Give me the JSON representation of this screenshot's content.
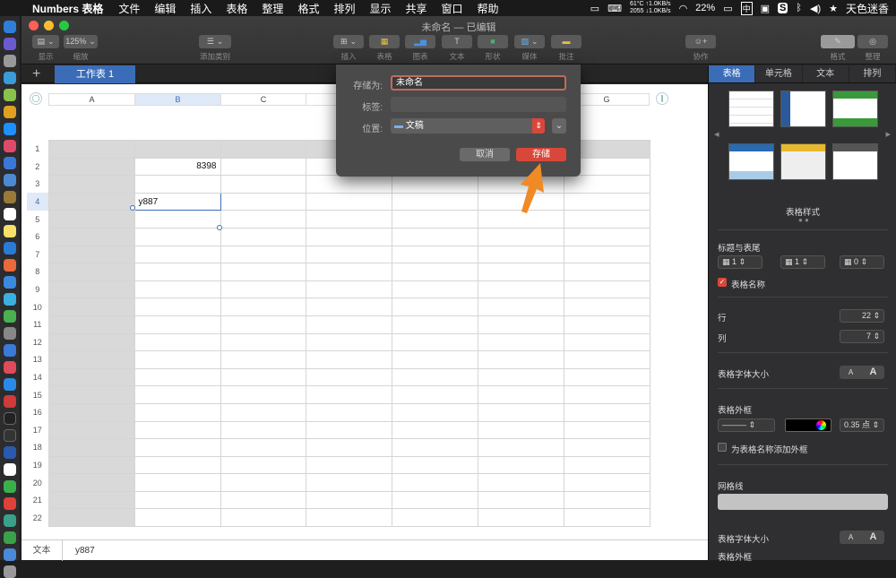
{
  "menubar": {
    "app_name": "Numbers 表格",
    "items": [
      "文件",
      "编辑",
      "插入",
      "表格",
      "整理",
      "格式",
      "排列",
      "显示",
      "共享",
      "窗口",
      "帮助"
    ],
    "temp": "61°C",
    "fan": "2055",
    "net_up": "↑1.0KB/s",
    "net_down": "↓1.0KB/s",
    "battery": "22%",
    "input_method": "中",
    "user": "天色迷香"
  },
  "window": {
    "title": "未命名 — 已编辑",
    "toolbar": {
      "view": "显示",
      "zoom_value": "125%",
      "zoom": "缩放",
      "add_category": "添加类别",
      "insert": "插入",
      "table": "表格",
      "chart": "图表",
      "text": "文本",
      "shape": "形状",
      "media": "媒体",
      "comment": "批注",
      "collaborate": "协作",
      "format": "格式",
      "organize": "整理"
    }
  },
  "sheet": {
    "tab_label": "工作表 1",
    "columns": [
      "A",
      "B",
      "C",
      "D",
      "E",
      "F",
      "G"
    ],
    "rows": [
      "1",
      "2",
      "3",
      "4",
      "5",
      "6",
      "7",
      "8",
      "9",
      "10",
      "11",
      "12",
      "13",
      "14",
      "15",
      "16",
      "17",
      "18",
      "19",
      "20",
      "21",
      "22"
    ],
    "cells": {
      "B2": "8398",
      "B4": "y887"
    }
  },
  "statusbar": {
    "label": "文本",
    "value": "y887"
  },
  "inspector": {
    "tabs": [
      "表格",
      "单元格",
      "文本",
      "排列"
    ],
    "styles_label": "表格样式",
    "headers_label": "标题与表尾",
    "header_rows": "1",
    "header_cols": "1",
    "footer_rows": "0",
    "table_name_label": "表格名称",
    "rows_label": "行",
    "rows_value": "22",
    "cols_label": "列",
    "cols_value": "7",
    "font_size_label": "表格字体大小",
    "font_small": "A",
    "font_large": "A",
    "outline_label": "表格外框",
    "outline_width": "0.35 点",
    "outline_name_label": "为表格名称添加外框",
    "gridlines_label": "网格线",
    "font_size_label2": "表格字体大小",
    "outline_label2": "表格外框"
  },
  "dialog": {
    "save_as_label": "存储为:",
    "save_as_value": "未命名",
    "tags_label": "标签:",
    "location_label": "位置:",
    "location_value": "文稿",
    "cancel": "取消",
    "save": "存储"
  },
  "colors": {
    "accent": "#3b6cb7",
    "save_button": "#d9473a",
    "arrow": "#f08a24"
  }
}
